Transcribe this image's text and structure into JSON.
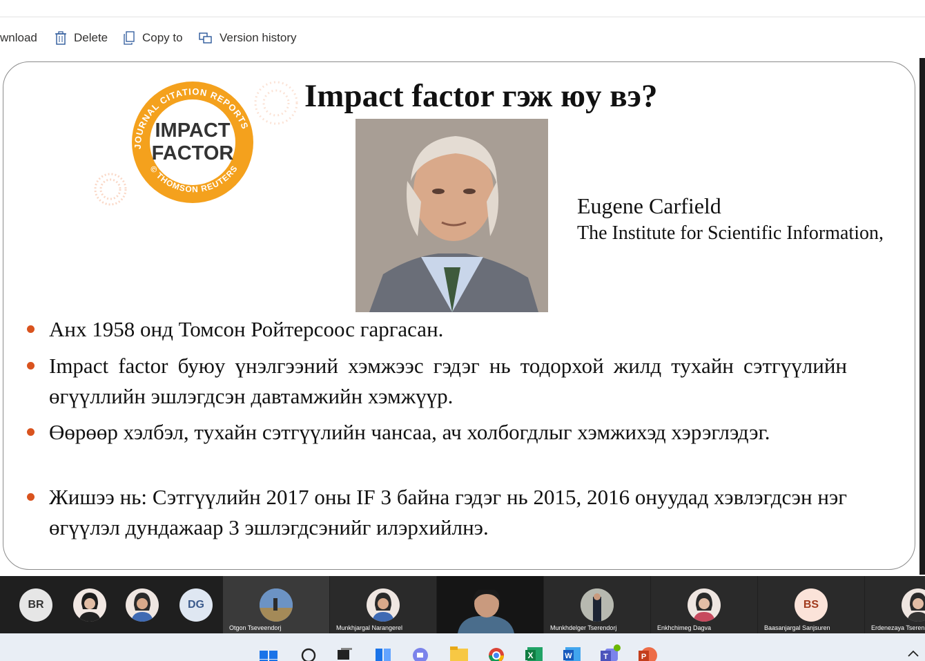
{
  "toolbar": {
    "download_label": "wnload",
    "delete_label": "Delete",
    "copy_label": "Copy to",
    "version_label": "Version history"
  },
  "slide": {
    "title": "Impact factor гэж юу вэ?",
    "logo": {
      "ring_text": "JOURNAL CITATION REPORTS 2013",
      "line1": "IMPACT",
      "line2": "FACTOR",
      "bottom_text": "© THOMSON REUTERS",
      "color": "#f4a11d"
    },
    "person_name": "Eugene Carfield",
    "person_org": "The Institute for Scientific Information,",
    "bullets": [
      "Анх 1958 онд Томсон Ройтерсоос гаргасан.",
      "Impact factor буюу үнэлгээний хэмжээс гэдэг нь тодорхой жилд тухайн сэтгүүлийн өгүүллийн эшлэгдсэн давтамжийн хэмжүүр.",
      "Өөрөөр хэлбэл, тухайн сэтгүүлийн чансаа, ач холбогдлыг хэмжихэд хэрэглэдэг.",
      "Жишээ нь: Сэтгүүлийн 2017 оны IF 3 байна гэдэг нь 2015, 2016 онуудад хэвлэгдсэн нэг өгүүлэл дундажаар 3 эшлэгдсэнийг илэрхийлнэ."
    ],
    "bullet_color": "#d9531e"
  },
  "participants": [
    {
      "initials": "BR",
      "name": "",
      "avatar_bg": "#e6e6e6",
      "avatar_fg": "#333333"
    },
    {
      "initials": "",
      "name": "",
      "avatar_bg": "#f2e8e3",
      "avatar_fg": "#333333"
    },
    {
      "initials": "",
      "name": "",
      "avatar_bg": "#efe6e1",
      "avatar_fg": "#333333"
    },
    {
      "initials": "DG",
      "name": "",
      "avatar_bg": "#dfe7f2",
      "avatar_fg": "#3b5a8c"
    },
    {
      "initials": "",
      "name": "Otgon Tseveendorj",
      "avatar_bg": "#7da0c8",
      "avatar_fg": "#333333"
    },
    {
      "initials": "",
      "name": "Munkhjargal Narangerel",
      "avatar_bg": "#efe6e1",
      "avatar_fg": "#333333"
    },
    {
      "initials": "",
      "name": "",
      "avatar_bg": "#5a4a4a",
      "avatar_fg": "#333333"
    },
    {
      "initials": "",
      "name": "Munkhdelger Tserendorj",
      "avatar_bg": "#8a8f86",
      "avatar_fg": "#333333"
    },
    {
      "initials": "",
      "name": "Enkhchimeg Dagva",
      "avatar_bg": "#efe6e1",
      "avatar_fg": "#333333"
    },
    {
      "initials": "BS",
      "name": "Baasanjargal Sanjsuren",
      "avatar_bg": "#fbe3d9",
      "avatar_fg": "#a13a1c"
    },
    {
      "initials": "",
      "name": "Erdenezaya Tserenk",
      "avatar_bg": "#efe6e1",
      "avatar_fg": "#333333"
    }
  ],
  "taskbar_icons": [
    "windows-start-icon",
    "search-icon",
    "task-view-icon",
    "widgets-icon",
    "teams-chat-icon",
    "file-explorer-icon",
    "chrome-icon",
    "excel-icon",
    "word-icon",
    "teams-icon",
    "powerpoint-icon",
    "chevron-up-icon"
  ]
}
